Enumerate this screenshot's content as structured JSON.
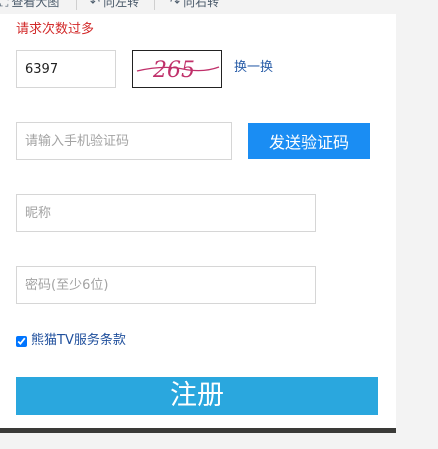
{
  "toolbar": {
    "view_full": "查看大图",
    "rotate_left": "向左转",
    "rotate_right": "向右转"
  },
  "form": {
    "error_message": "请求次数过多",
    "captcha_value": "6397",
    "captcha_image_text": "265",
    "captcha_refresh": "换一换",
    "sms_placeholder": "请输入手机验证码",
    "send_code_label": "发送验证码",
    "nickname_placeholder": "昵称",
    "password_placeholder": "密码(至少6位)",
    "terms_label": "熊猫TV服务条款",
    "terms_checked": true,
    "register_label": "注册"
  },
  "colors": {
    "error": "#d22a2a",
    "link": "#2a5ea8",
    "send_button": "#1a8df3",
    "register_button": "#2aa7de"
  }
}
